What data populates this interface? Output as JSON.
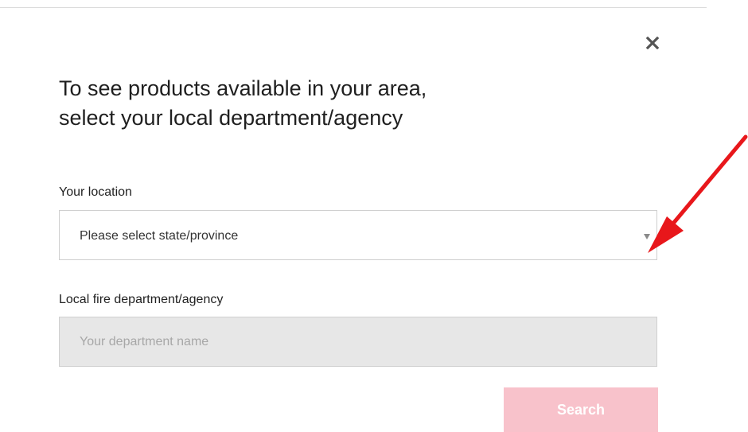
{
  "modal": {
    "heading": "To see products available in your area,\nselect your local department/agency",
    "close_icon": "close-icon"
  },
  "location": {
    "label": "Your location",
    "selected_value": "Please select state/province",
    "caret_icon": "caret-down-icon"
  },
  "department": {
    "label": "Local fire department/agency",
    "placeholder": "Your department name",
    "value": ""
  },
  "search": {
    "label": "Search",
    "bg_color": "#f8c2cb"
  },
  "annotation": {
    "icon": "red-arrow-icon",
    "color": "#e8171b"
  }
}
